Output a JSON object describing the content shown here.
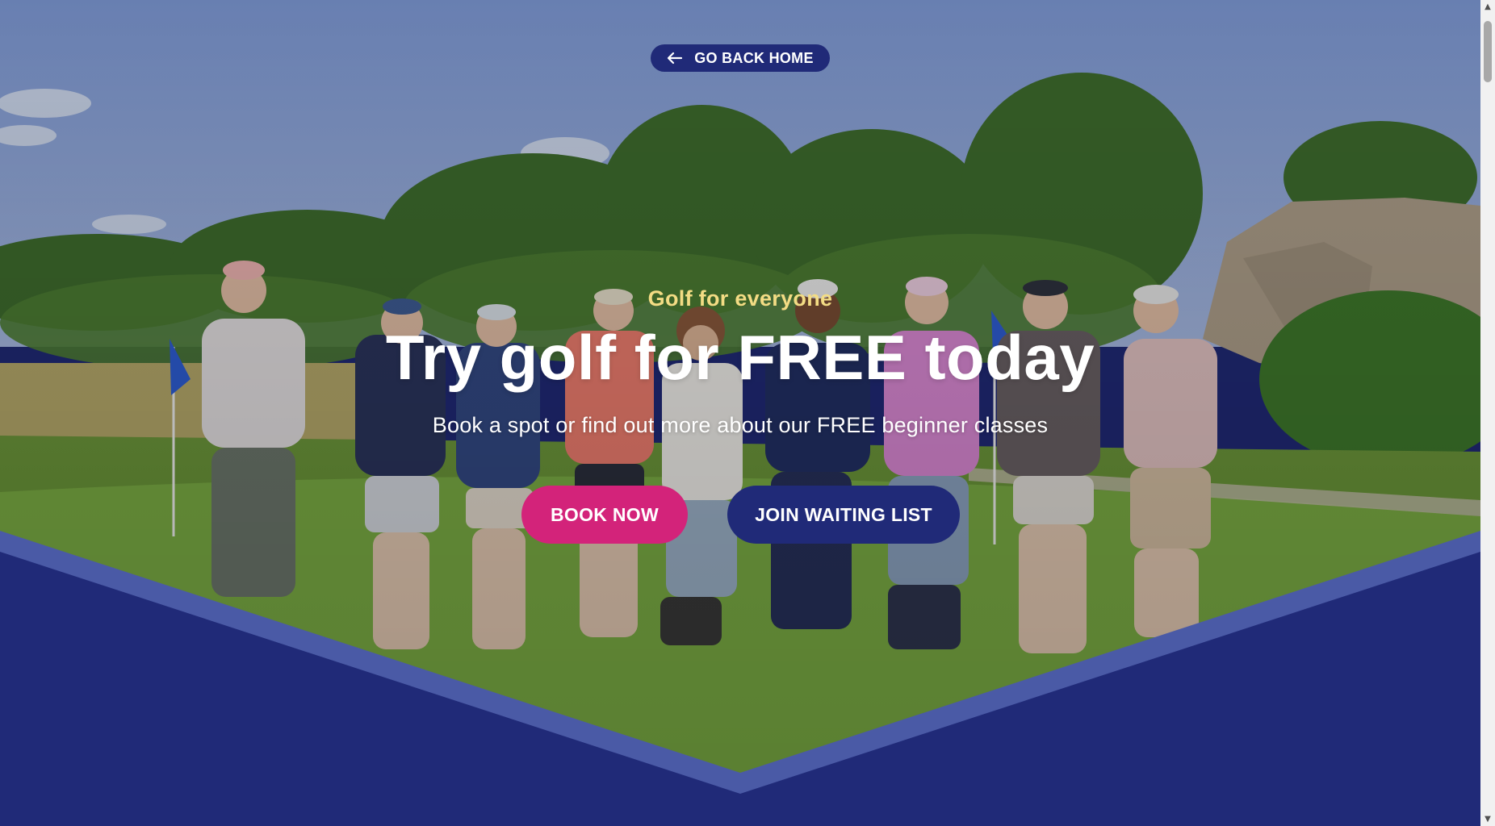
{
  "nav": {
    "back_label": "GO BACK HOME"
  },
  "hero": {
    "eyebrow": "Golf for everyone",
    "headline": "Try golf for FREE today",
    "subheadline": "Book a spot or find out more about our FREE beginner classes",
    "photo_alt": "Group of golfers standing on a putting green",
    "book_label": "BOOK NOW",
    "waitlist_label": "JOIN WAITING LIST"
  },
  "icons": {
    "back": "arrow-left-icon",
    "scroll_up": "triangle-up-icon",
    "scroll_down": "triangle-down-icon"
  },
  "colors": {
    "navy": "#202a78",
    "navy_light": "#4a5aa6",
    "accent_pink": "#d3237a",
    "eyebrow_yellow": "#f3dc84"
  }
}
